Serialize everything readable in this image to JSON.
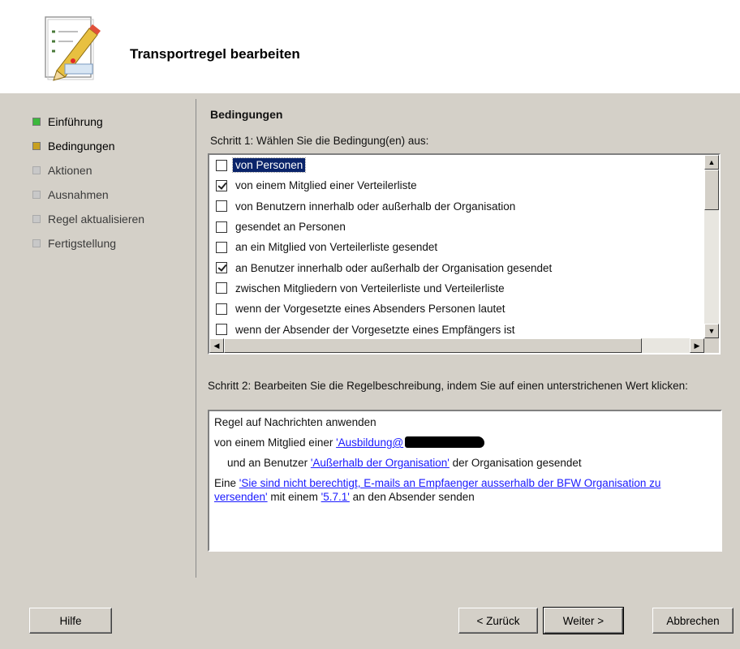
{
  "header": {
    "title": "Transportregel bearbeiten",
    "icon": "edit-document-icon"
  },
  "nav": {
    "items": [
      {
        "label": "Einführung",
        "state": "completed",
        "color": "#3cb83c"
      },
      {
        "label": "Bedingungen",
        "state": "current",
        "color": "#c8a020"
      },
      {
        "label": "Aktionen",
        "state": "pending",
        "color": "#c8c8c8"
      },
      {
        "label": "Ausnahmen",
        "state": "pending",
        "color": "#c8c8c8"
      },
      {
        "label": "Regel aktualisieren",
        "state": "pending",
        "color": "#c8c8c8"
      },
      {
        "label": "Fertigstellung",
        "state": "pending",
        "color": "#c8c8c8"
      }
    ]
  },
  "main": {
    "heading": "Bedingungen",
    "step1_label": "Schritt 1: Wählen Sie die Bedingung(en) aus:",
    "conditions": [
      {
        "label": "von Personen",
        "checked": false,
        "selected": true
      },
      {
        "label": "von einem Mitglied einer Verteilerliste",
        "checked": true,
        "selected": false
      },
      {
        "label": "von Benutzern innerhalb oder außerhalb der Organisation",
        "checked": false,
        "selected": false
      },
      {
        "label": "gesendet an Personen",
        "checked": false,
        "selected": false
      },
      {
        "label": "an ein Mitglied von Verteilerliste gesendet",
        "checked": false,
        "selected": false
      },
      {
        "label": "an Benutzer innerhalb oder außerhalb der Organisation gesendet",
        "checked": true,
        "selected": false
      },
      {
        "label": "zwischen Mitgliedern von Verteilerliste und Verteilerliste",
        "checked": false,
        "selected": false
      },
      {
        "label": "wenn der Vorgesetzte eines Absenders Personen lautet",
        "checked": false,
        "selected": false
      },
      {
        "label": "wenn der Absender der Vorgesetzte eines Empfängers ist",
        "checked": false,
        "selected": false
      }
    ],
    "step2_label": "Schritt 2: Bearbeiten Sie die Regelbeschreibung, indem Sie auf einen unterstrichenen Wert klicken:",
    "description": {
      "line1": "Regel auf Nachrichten anwenden",
      "line2_prefix": "von einem Mitglied einer ",
      "line2_link": "'Ausbildung@",
      "line3_prefix": "und an Benutzer ",
      "line3_link": "'Außerhalb der Organisation'",
      "line3_suffix": " der Organisation gesendet",
      "line4_prefix": "Eine ",
      "line4_link1": "'Sie sind nicht berechtigt, E-mails an Empfaenger ausserhalb der BFW Organisation zu versenden'",
      "line4_mid": " mit einem ",
      "line4_link2": "'5.7.1'",
      "line4_suffix": " an den Absender senden"
    }
  },
  "buttons": {
    "help": "Hilfe",
    "back": "< Zurück",
    "next": "Weiter >",
    "cancel": "Abbrechen"
  }
}
